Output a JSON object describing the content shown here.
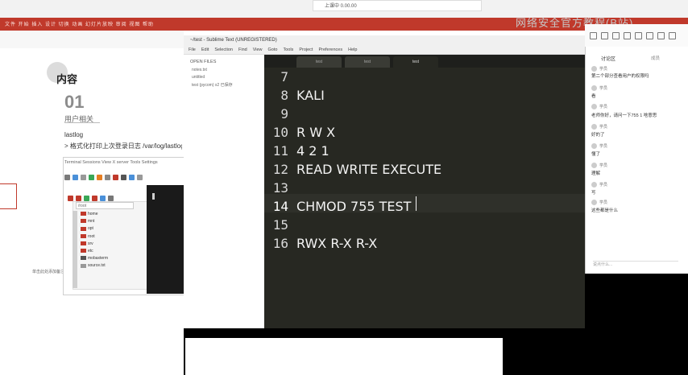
{
  "browser": {
    "tab_label": "上课中 0.00.00",
    "menu_bar": "文件  开始  插入  设计  切换  动画  幻灯片放映  审阅  视图  帮助"
  },
  "watermark": "网络安全官方教程(B站)",
  "slide": {
    "title": "内容",
    "number": "01",
    "subtitle": "用户相关",
    "line1": "lastlog",
    "line2": "> 格式化打印上次登录日志 /var/log/lastlog",
    "footer": "单击此处添加备注"
  },
  "vm": {
    "menu": "Terminal  Sessions  View  X server  Tools  Settings",
    "path": "/root",
    "files": [
      "home",
      "mnt",
      "opt",
      "root",
      "srv",
      "etc",
      "mobaxterm",
      "source.txt"
    ]
  },
  "sublime": {
    "title": "~/test - Sublime Text (UNREGISTERED)",
    "menu": [
      "File",
      "Edit",
      "Selection",
      "Find",
      "View",
      "Goto",
      "Tools",
      "Project",
      "Preferences",
      "Help"
    ],
    "sidebar_header": "OPEN FILES",
    "sidebar_files": [
      "notes.txt",
      "untitled",
      "test (pycom) x2  已保存"
    ],
    "tabs": [
      "test",
      "test",
      "test"
    ],
    "lines": [
      {
        "n": "7",
        "text": ""
      },
      {
        "n": "8",
        "text": "KALI"
      },
      {
        "n": "9",
        "text": ""
      },
      {
        "n": "10",
        "text": "R W X"
      },
      {
        "n": "11",
        "text": "4 2 1"
      },
      {
        "n": "12",
        "text": "READ WRITE EXECUTE"
      },
      {
        "n": "13",
        "text": ""
      },
      {
        "n": "14",
        "text": "CHMOD 755 TEST"
      },
      {
        "n": "15",
        "text": ""
      },
      {
        "n": "16",
        "text": "RWX R-X R-X"
      }
    ]
  },
  "chat": {
    "tab": "讨论区",
    "tab2": "成员",
    "messages": [
      {
        "name": "学员",
        "text": "第二个部分查看用户的权限吗"
      },
      {
        "name": "学员",
        "text": "看"
      },
      {
        "name": "学员",
        "text": "老师你好，请问一下755 1 啥意思"
      },
      {
        "name": "学员",
        "text": "好的了"
      },
      {
        "name": "学员",
        "text": "懂了"
      },
      {
        "name": "学员",
        "text": "理解"
      },
      {
        "name": "学员",
        "text": "写"
      },
      {
        "name": "学员",
        "text": "这些都是什么"
      }
    ],
    "input_placeholder": "说点什么..."
  }
}
